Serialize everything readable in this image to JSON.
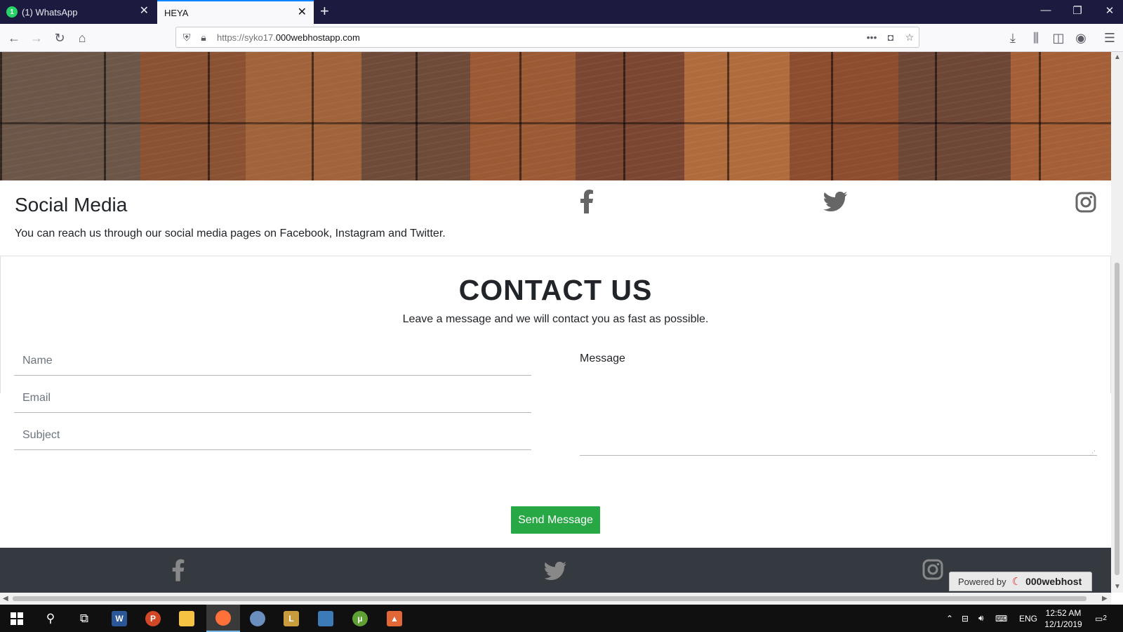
{
  "browser": {
    "tabs": [
      {
        "title": "(1) WhatsApp",
        "badge": "1",
        "active": false
      },
      {
        "title": "HEYA",
        "active": true
      }
    ],
    "url_prefix": "https://syko17.",
    "url_domain": "000webhostapp.com"
  },
  "page": {
    "social": {
      "title": "Social Media",
      "text": "You can reach us through our social media pages on Facebook, Instagram and Twitter."
    },
    "contact": {
      "title": "CONTACT US",
      "subtitle": "Leave a message and we will contact you as fast as possible.",
      "name_placeholder": "Name",
      "email_placeholder": "Email",
      "subject_placeholder": "Subject",
      "message_label": "Message",
      "send_label": "Send Message"
    },
    "powered_by": {
      "prefix": "Powered by",
      "brand": "000webhost"
    }
  },
  "taskbar": {
    "language": "ENG",
    "time": "12:52 AM",
    "date": "12/1/2019",
    "notifications": "2"
  },
  "colors": {
    "accent": "#0a84ff",
    "send_button": "#28a745",
    "footer": "#343a40",
    "titlebar": "#1c1b3f"
  }
}
